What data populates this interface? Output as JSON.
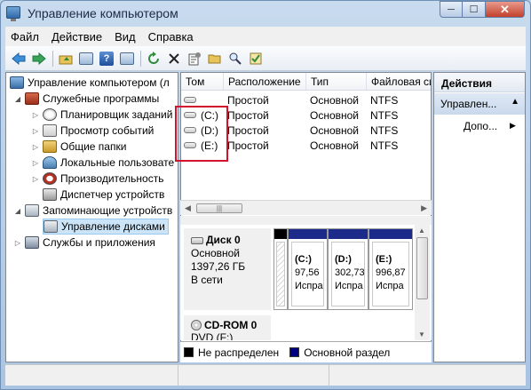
{
  "window": {
    "title": "Управление компьютером",
    "min_glyph": "─",
    "max_glyph": "☐",
    "close_glyph": "✕"
  },
  "menu": [
    "Файл",
    "Действие",
    "Вид",
    "Справка"
  ],
  "toolbar": {
    "help_glyph": "?"
  },
  "tree": {
    "root": "Управление компьютером (л",
    "system_tools": "Служебные программы",
    "task_scheduler": "Планировщик заданий",
    "event_viewer": "Просмотр событий",
    "shared_folders": "Общие папки",
    "local_users": "Локальные пользовате",
    "performance": "Производительность",
    "device_manager": "Диспетчер устройств",
    "storage": "Запоминающие устройств",
    "disk_management": "Управление дисками",
    "services": "Службы и приложения"
  },
  "volumes": {
    "columns": [
      "Том",
      "Расположение",
      "Тип",
      "Файловая сис"
    ],
    "rows": [
      {
        "name": "",
        "layout": "Простой",
        "type": "Основной",
        "fs": "NTFS"
      },
      {
        "name": "(C:)",
        "layout": "Простой",
        "type": "Основной",
        "fs": "NTFS"
      },
      {
        "name": "(D:)",
        "layout": "Простой",
        "type": "Основной",
        "fs": "NTFS"
      },
      {
        "name": "(E:)",
        "layout": "Простой",
        "type": "Основной",
        "fs": "NTFS"
      }
    ]
  },
  "disks": {
    "disk0": {
      "name": "Диск 0",
      "type": "Основной",
      "size": "1397,26 ГБ",
      "status": "В сети"
    },
    "partitions": [
      {
        "letter": "(C:)",
        "size": "97,56",
        "status": "Испра"
      },
      {
        "letter": "(D:)",
        "size": "302,73",
        "status": "Испра"
      },
      {
        "letter": "(E:)",
        "size": "996,87",
        "status": "Испра"
      }
    ],
    "cdrom": {
      "name": "CD-ROM 0",
      "type": "DVD (F:)"
    }
  },
  "legend": {
    "unallocated": "Не распределен",
    "primary": "Основной раздел",
    "unallocated_color": "#000000",
    "primary_color": "#000080"
  },
  "actions": {
    "header": "Действия",
    "section": "Управлен...",
    "more": "Допо..."
  },
  "colors": {
    "partition_header": "#1c2a8a",
    "highlight": "#d3122e",
    "selection": "#cce4f7"
  }
}
